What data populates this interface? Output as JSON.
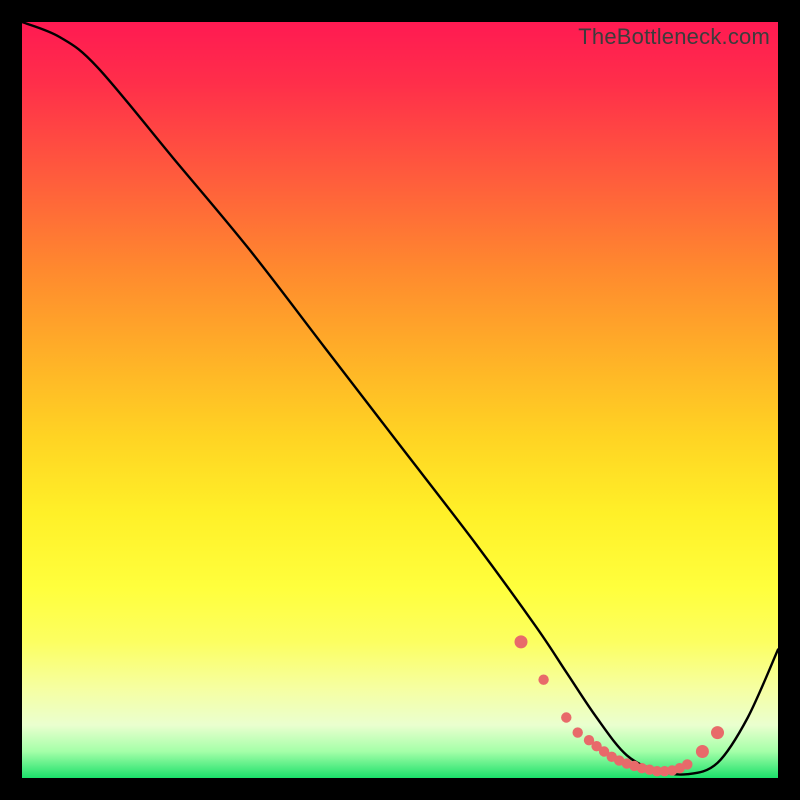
{
  "watermark": "TheBottleneck.com",
  "chart_data": {
    "type": "line",
    "title": "",
    "xlabel": "",
    "ylabel": "",
    "xlim": [
      0,
      100
    ],
    "ylim": [
      0,
      100
    ],
    "series": [
      {
        "name": "curve",
        "x": [
          0,
          5,
          10,
          20,
          30,
          40,
          50,
          60,
          68,
          72,
          76,
          80,
          84,
          88,
          92,
          96,
          100
        ],
        "y": [
          100,
          98,
          94,
          82,
          70,
          57,
          44,
          31,
          20,
          14,
          8,
          3,
          1,
          0.5,
          2,
          8,
          17
        ]
      }
    ],
    "markers": {
      "name": "highlight-points",
      "x": [
        66,
        69,
        72,
        73.5,
        75,
        76,
        77,
        78,
        79,
        80,
        81,
        82,
        83,
        84,
        85,
        86,
        87,
        88,
        90,
        92
      ],
      "y": [
        18,
        13,
        8,
        6,
        5,
        4.2,
        3.5,
        2.8,
        2.3,
        1.9,
        1.6,
        1.3,
        1.1,
        0.9,
        0.9,
        1.0,
        1.3,
        1.8,
        3.5,
        6
      ]
    },
    "gradient_stops": [
      {
        "pos": 0,
        "color": "#ff1a52"
      },
      {
        "pos": 0.55,
        "color": "#ffd423"
      },
      {
        "pos": 0.82,
        "color": "#fcff61"
      },
      {
        "pos": 1.0,
        "color": "#1be06a"
      }
    ]
  }
}
